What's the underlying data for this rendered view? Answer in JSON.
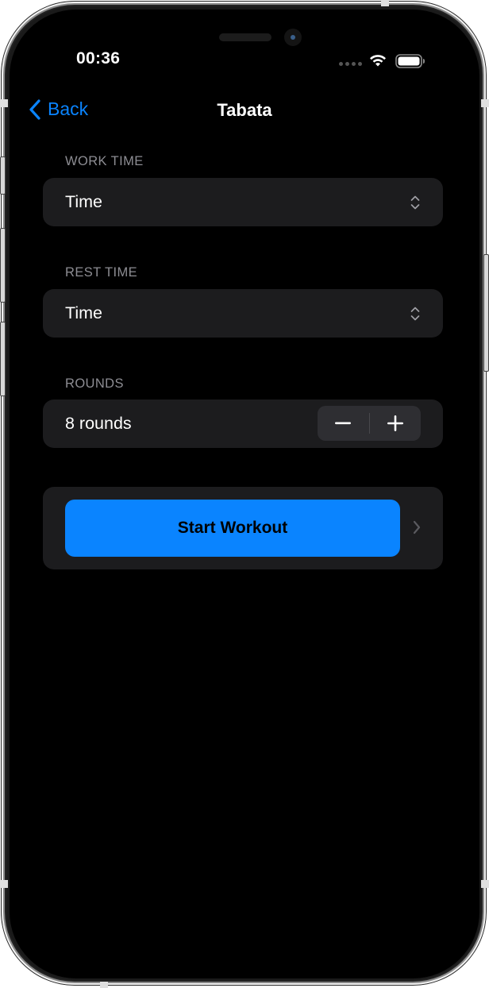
{
  "status_bar": {
    "time": "00:36",
    "icons": [
      "cellular-dots-icon",
      "wifi-icon",
      "battery-icon"
    ]
  },
  "nav": {
    "back_label": "Back",
    "back_icon": "chevron-left-icon",
    "title": "Tabata"
  },
  "form": {
    "work_time": {
      "label": "WORK TIME",
      "value": "Time",
      "icon": "chevron-up-down-icon"
    },
    "rest_time": {
      "label": "REST TIME",
      "value": "Time",
      "icon": "chevron-up-down-icon"
    },
    "rounds": {
      "label": "ROUNDS",
      "value": "8 rounds",
      "count": 8,
      "decrement_icon": "minus-icon",
      "increment_icon": "plus-icon"
    },
    "start": {
      "label": "Start Workout",
      "icon": "chevron-right-icon"
    }
  },
  "colors": {
    "accent": "#0a84ff",
    "background": "#000000",
    "card": "#1c1c1e",
    "secondary_label": "#8d8d93",
    "stepper": "#2e2e32"
  }
}
